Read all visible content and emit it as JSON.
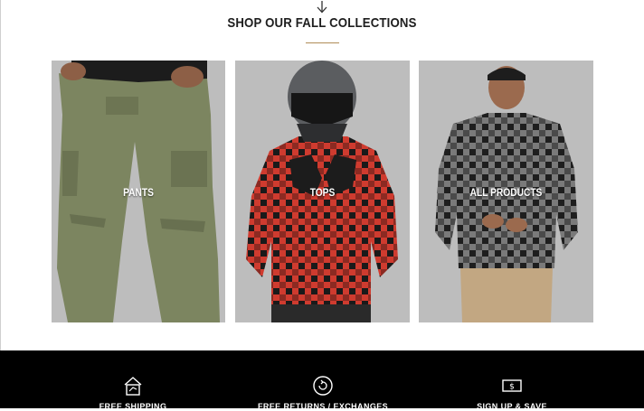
{
  "section": {
    "heading": "SHOP OUR FALL COLLECTIONS",
    "accent_color": "#b08d57"
  },
  "collections": [
    {
      "label": "PANTS",
      "bg": "#bdbdbd"
    },
    {
      "label": "TOPS",
      "bg": "#bdbdbd"
    },
    {
      "label": "ALL PRODUCTS",
      "bg": "#bdbdbd"
    }
  ],
  "footer": {
    "bg": "#000000",
    "features": [
      {
        "icon": "shipping-house-icon",
        "label": "FREE SHIPPING"
      },
      {
        "icon": "return-arrow-icon",
        "label": "FREE RETURNS / EXCHANGES"
      },
      {
        "icon": "dollar-bill-icon",
        "label": "SIGN UP & SAVE"
      }
    ]
  }
}
